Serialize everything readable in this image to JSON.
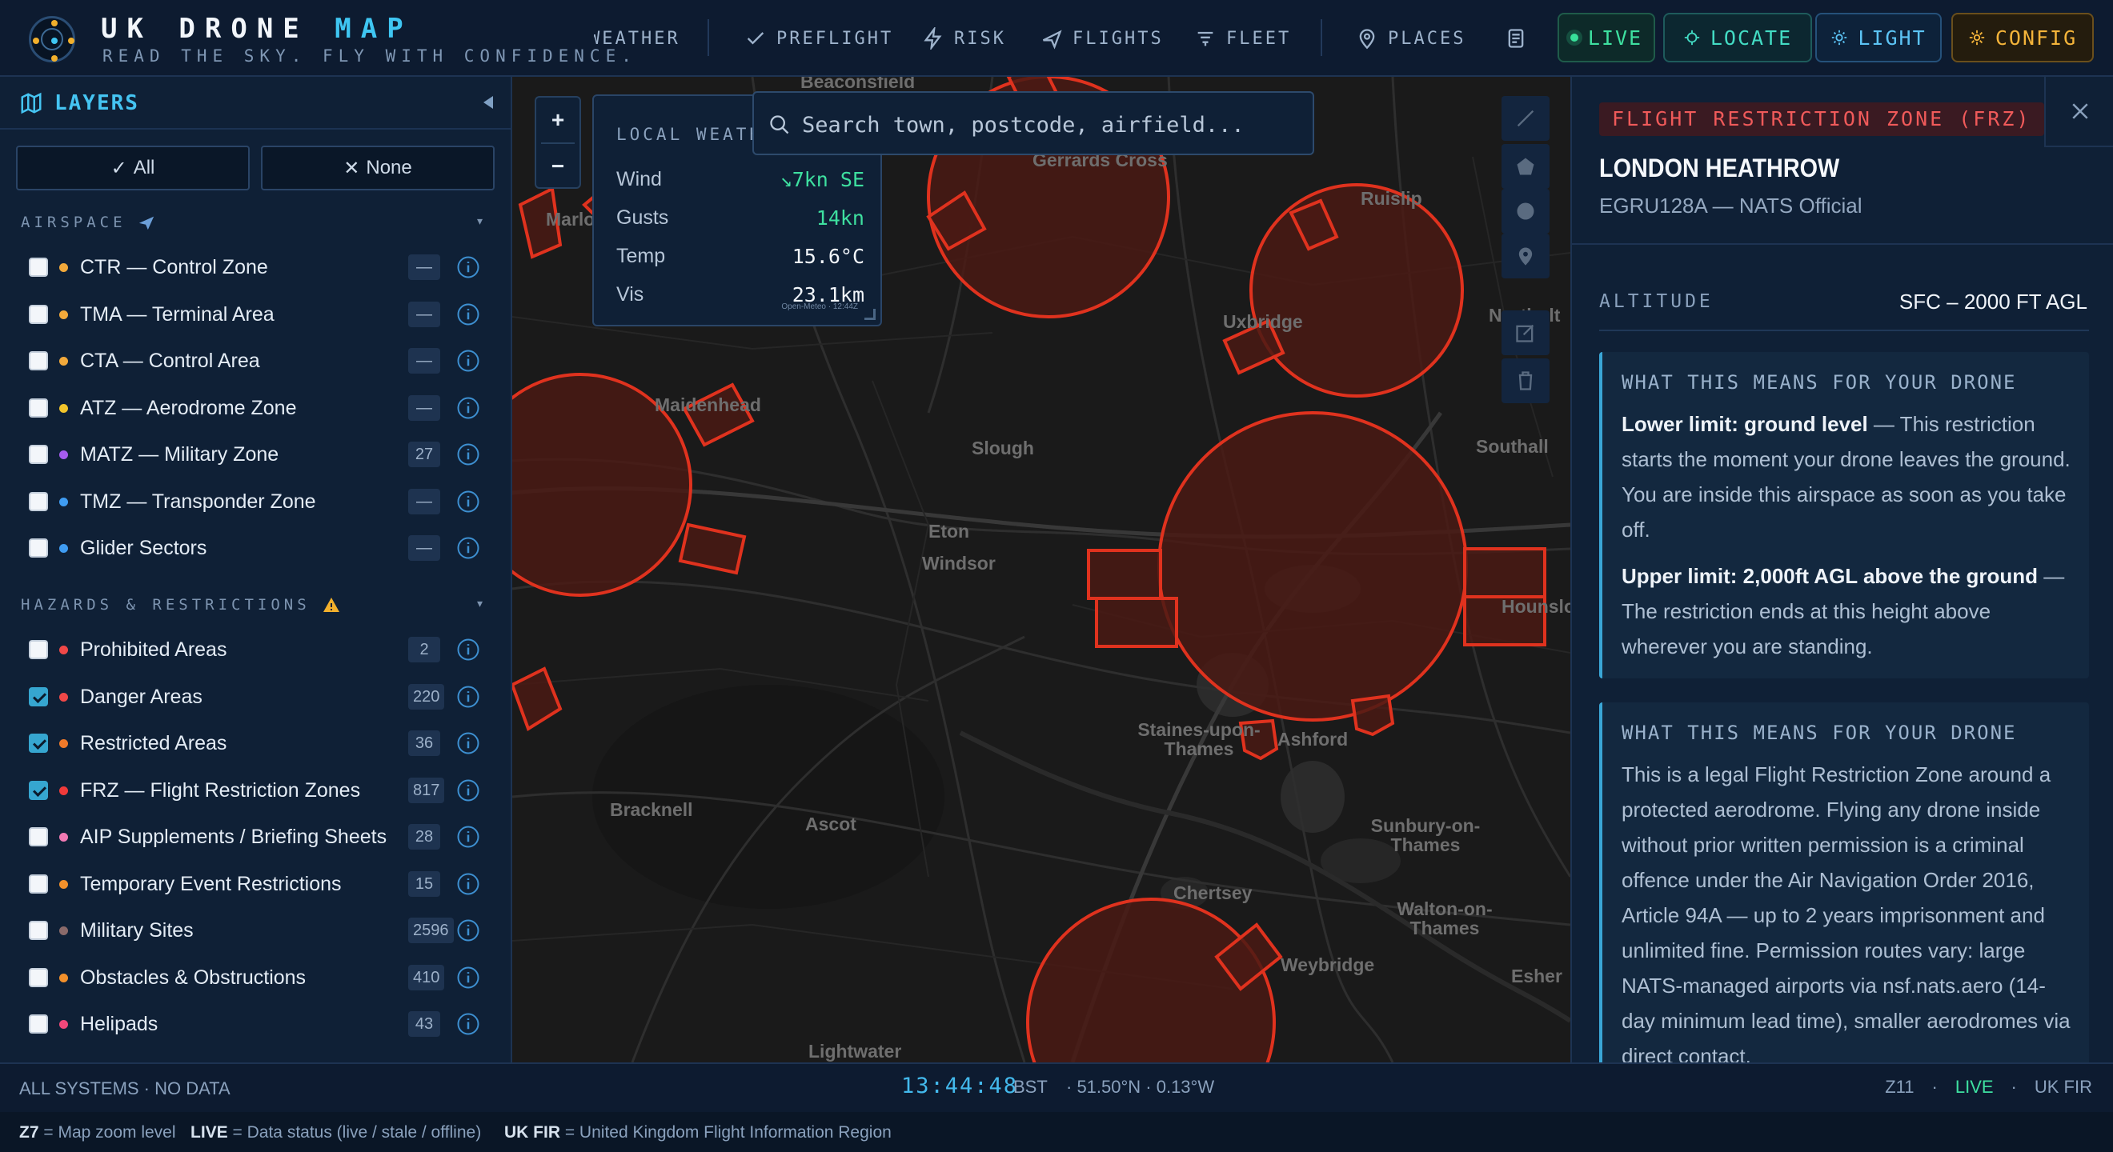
{
  "brand": {
    "title_main": "UK DRONE",
    "title_accent": "MAP",
    "tagline": "READ THE SKY. FLY WITH CONFIDENCE."
  },
  "nav": {
    "items": [
      {
        "label": "WEATHER",
        "icon": "cloud-icon"
      },
      {
        "label": "PREFLIGHT",
        "icon": "check-icon"
      },
      {
        "label": "RISK",
        "icon": "lightning-icon"
      },
      {
        "label": "FLIGHTS",
        "icon": "plane-icon"
      },
      {
        "label": "FLEET",
        "icon": "fleet-icon"
      },
      {
        "label": "PLACES",
        "icon": "pin-icon"
      }
    ],
    "buttons": {
      "live": "LIVE",
      "locate": "LOCATE",
      "light": "LIGHT",
      "config": "CONFIG"
    }
  },
  "layers": {
    "title": "LAYERS",
    "all_label": "All",
    "none_label": "None",
    "sections": [
      {
        "title": "AIRSPACE",
        "items": [
          {
            "label": "CTR — Control Zone",
            "count": "—",
            "color": "#f2a93b",
            "checked": false
          },
          {
            "label": "TMA — Terminal Area",
            "count": "—",
            "color": "#f2a93b",
            "checked": false
          },
          {
            "label": "CTA — Control Area",
            "count": "—",
            "color": "#f2a93b",
            "checked": false
          },
          {
            "label": "ATZ — Aerodrome Zone",
            "count": "—",
            "color": "#f2c42b",
            "checked": false
          },
          {
            "label": "MATZ — Military Zone",
            "count": "27",
            "color": "#a65cf0",
            "checked": false
          },
          {
            "label": "TMZ — Transponder Zone",
            "count": "—",
            "color": "#3f9cf2",
            "checked": false
          },
          {
            "label": "Glider Sectors",
            "count": "—",
            "color": "#3f9cf2",
            "checked": false
          }
        ]
      },
      {
        "title": "HAZARDS & RESTRICTIONS",
        "items": [
          {
            "label": "Prohibited Areas",
            "count": "2",
            "color": "#f04848",
            "checked": false
          },
          {
            "label": "Danger Areas",
            "count": "220",
            "color": "#f04848",
            "checked": true
          },
          {
            "label": "Restricted Areas",
            "count": "36",
            "color": "#f07a2a",
            "checked": true
          },
          {
            "label": "FRZ — Flight Restriction Zones",
            "count": "817",
            "color": "#f03a3a",
            "checked": true
          },
          {
            "label": "AIP Supplements / Briefing Sheets",
            "count": "28",
            "color": "#f27ab4",
            "checked": false
          },
          {
            "label": "Temporary Event Restrictions",
            "count": "15",
            "color": "#f2902b",
            "checked": false
          },
          {
            "label": "Military Sites",
            "count": "2596",
            "color": "#8a6a6a",
            "checked": false
          },
          {
            "label": "Obstacles & Obstructions",
            "count": "410",
            "color": "#f2902b",
            "checked": false
          },
          {
            "label": "Helipads",
            "count": "43",
            "color": "#f0487a",
            "checked": false
          }
        ]
      }
    ]
  },
  "map": {
    "search_placeholder": "Search town, postcode, airfield...",
    "weather": {
      "title": "LOCAL WEATHER",
      "rows": [
        {
          "k": "Wind",
          "v": "↘7kn SE",
          "color": "#3ee0a0"
        },
        {
          "k": "Gusts",
          "v": "14kn",
          "color": "#3ee0a0"
        },
        {
          "k": "Temp",
          "v": "15.6°C",
          "color": "#f2f6fb"
        },
        {
          "k": "Vis",
          "v": "23.1km",
          "color": "#f2f6fb"
        }
      ],
      "source": "Open-Meteo · 12:44Z"
    },
    "places": [
      "Beaconsfield",
      "Gerrards Cross",
      "Ruislip",
      "Marlow",
      "Uxbridge",
      "Northolt",
      "Maidenhead",
      "Slough",
      "Southall",
      "Eton",
      "Windsor",
      "Hounslow",
      "Staines-upon-Thames",
      "Ashford",
      "Bracknell",
      "Ascot",
      "Sunbury-on-Thames",
      "Chertsey",
      "Walton-on-Thames",
      "Weybridge",
      "Esher",
      "Lightwater"
    ]
  },
  "zone": {
    "badge": "FLIGHT RESTRICTION ZONE (FRZ)",
    "name": "LONDON HEATHROW",
    "code": "EGRU128A — NATS Official",
    "altitude_label": "ALTITUDE",
    "altitude_value": "SFC – 2000 FT AGL",
    "card1": {
      "title": "WHAT THIS MEANS FOR YOUR DRONE",
      "p1_bold": "Lower limit: ground level",
      "p1_text": " — This restriction starts the moment your drone leaves the ground. You are inside this airspace as soon as you take off.",
      "p2_bold": "Upper limit: 2,000ft AGL above the ground",
      "p2_text": " — The restriction ends at this height above wherever you are standing."
    },
    "card2": {
      "title": "WHAT THIS MEANS FOR YOUR DRONE",
      "text": "This is a legal Flight Restriction Zone around a protected aerodrome. Flying any drone inside without prior written permission is a criminal offence under the Air Navigation Order 2016, Article 94A — up to 2 years imprisonment and unlimited fine. Permission routes vary: large NATS-managed airports via nsf.nats.aero (14-day minimum lead time), smaller aerodromes via direct contact."
    }
  },
  "status": {
    "left": "ALL SYSTEMS · NO DATA",
    "clock": "13:44:48",
    "tz": "BST",
    "coords": "·  51.50°N · 0.13°W",
    "zoom": "Z11",
    "live": "LIVE",
    "fir": "UK FIR"
  },
  "legend": [
    {
      "key": "Z7",
      "text": " = Map zoom level"
    },
    {
      "key": "LIVE",
      "text": " = Data status (live / stale / offline)"
    },
    {
      "key": "UK FIR",
      "text": " = United Kingdom Flight Information Region"
    }
  ]
}
